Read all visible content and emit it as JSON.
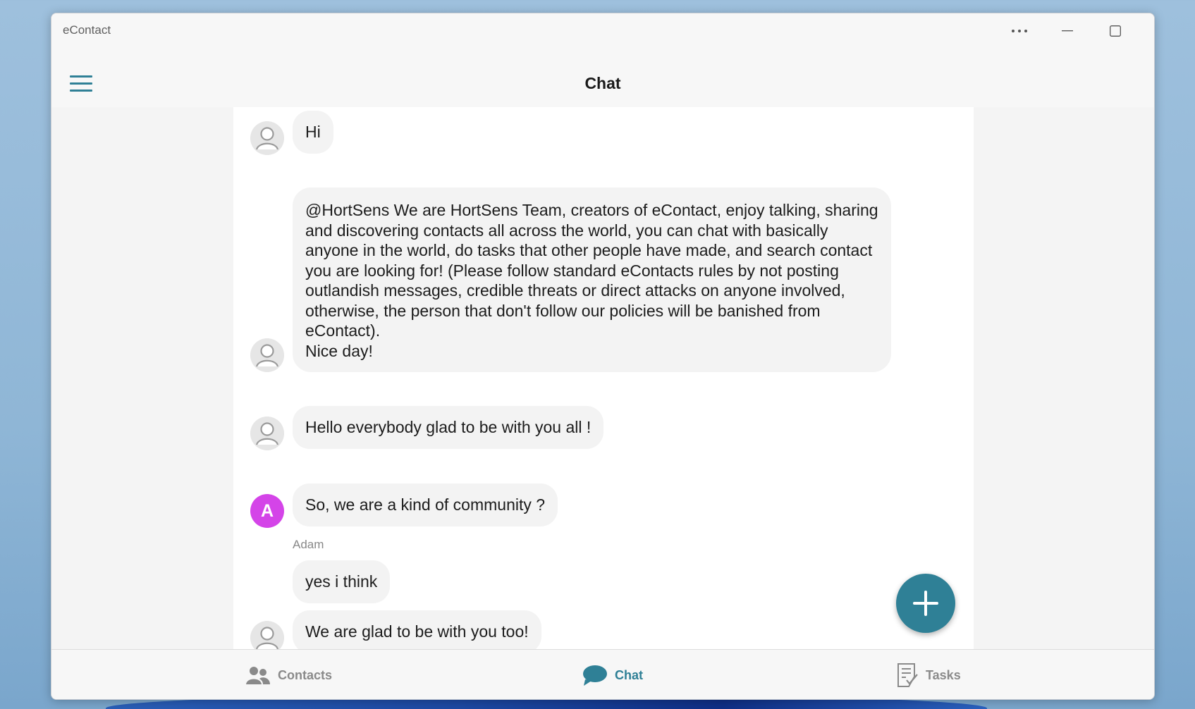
{
  "window": {
    "app_title": "eContact",
    "controls": {
      "more": "more-icon",
      "minimize": "minimize-icon",
      "maximize": "maximize-icon",
      "close": "close-icon"
    }
  },
  "header": {
    "menu_icon": "hamburger-menu-icon",
    "title": "Chat"
  },
  "messages": [
    {
      "avatar": "default",
      "text": "Hi"
    },
    {
      "avatar": "default",
      "text": "@HortSens We are HortSens Team, creators of eContact, enjoy talking, sharing\nand discovering contacts all across the world, you can chat with basically\nanyone in the world, do tasks that other people have made, and search contact\nyou are looking for! (Please follow standard eContacts rules by not posting\noutlandish messages, credible threats or direct attacks on anyone involved,\notherwise, the person that don't follow our policies will be banished from\neContact).\nNice day!"
    },
    {
      "avatar": "default",
      "text": "Hello everybody glad to be with you all !"
    },
    {
      "avatar": "letter",
      "avatar_letter": "A",
      "avatar_color": "#d444e8",
      "text": "So, we are a kind of community ?",
      "sender": "Adam"
    },
    {
      "avatar": "none",
      "text": "yes i think"
    },
    {
      "avatar": "default",
      "text": "We are glad to be with you too!"
    }
  ],
  "fab": {
    "icon": "plus-icon"
  },
  "bottom_nav": [
    {
      "label": "Contacts",
      "icon": "contacts-icon",
      "active": false
    },
    {
      "label": "Chat",
      "icon": "chat-bubble-icon",
      "active": true
    },
    {
      "label": "Tasks",
      "icon": "tasks-icon",
      "active": false
    }
  ],
  "colors": {
    "accent": "#2f8096",
    "bubble": "#f3f3f3",
    "avatar_letter_bg": "#d444e8"
  }
}
